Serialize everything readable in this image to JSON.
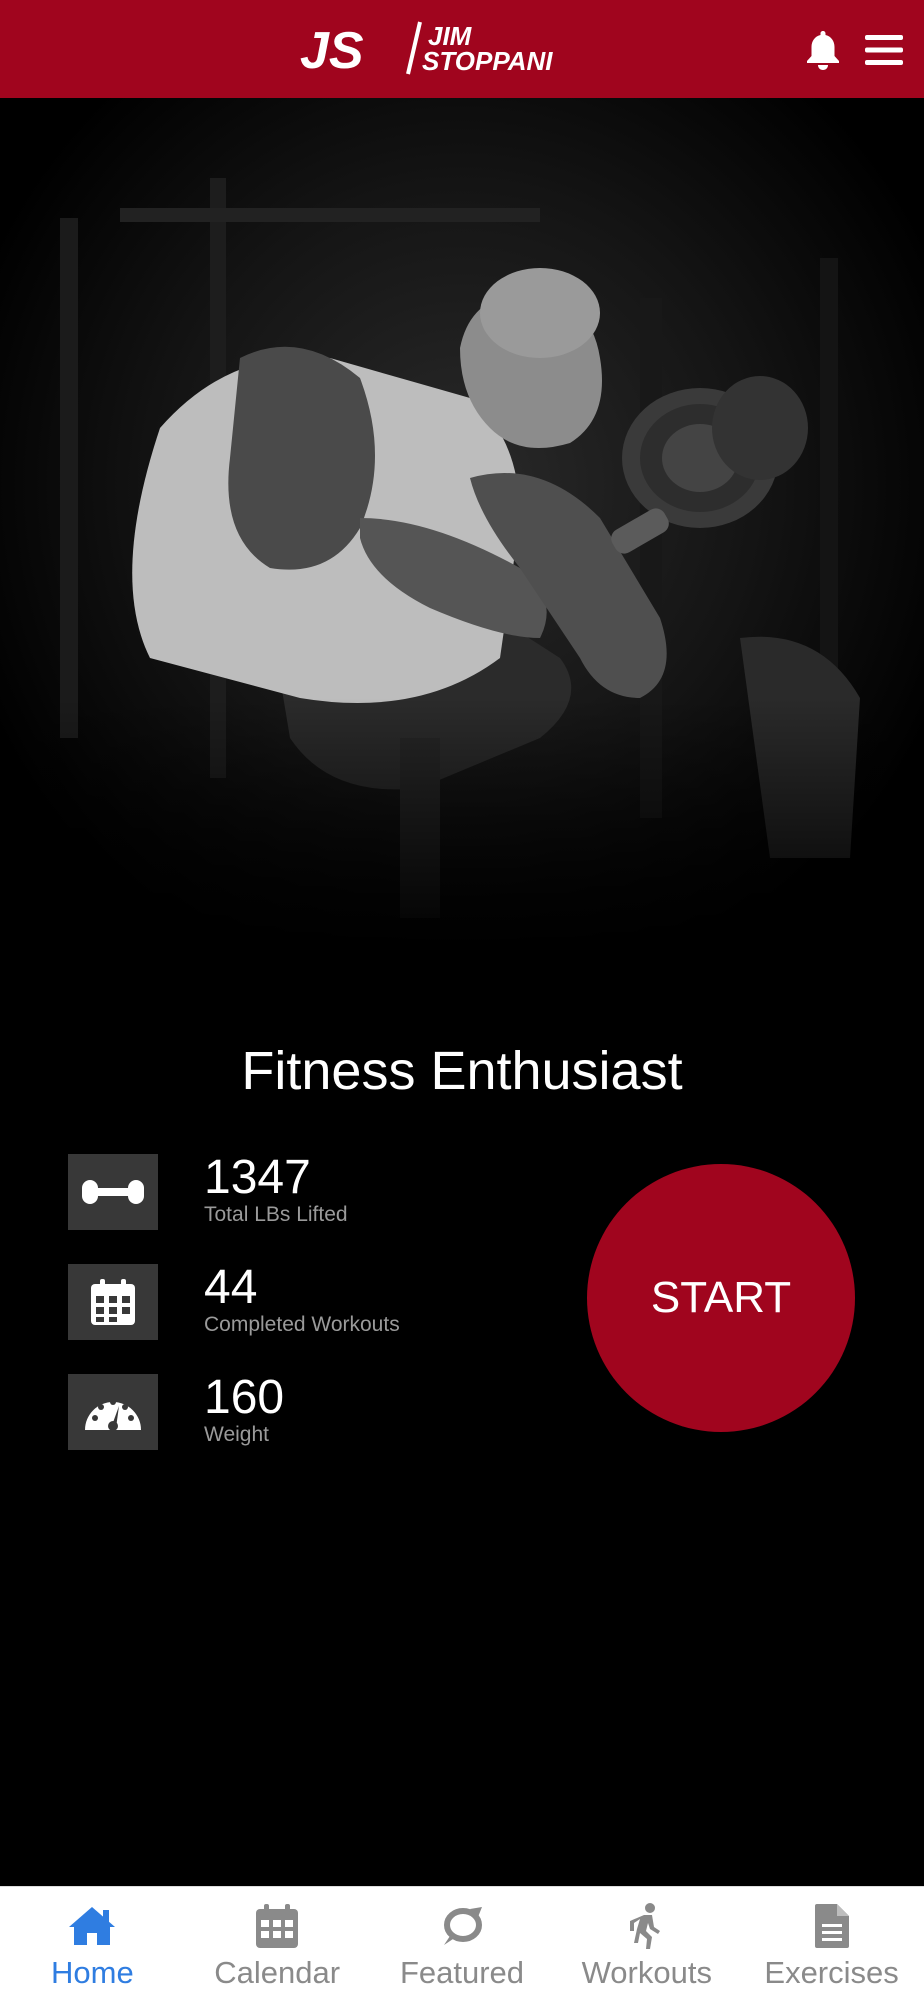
{
  "header": {
    "logo_text_initials": "JS",
    "logo_text_name_line1": "JIM",
    "logo_text_name_line2": "STOPPANI",
    "brand_color": "#a0051e",
    "bell_icon": "bell-icon",
    "menu_icon": "hamburger-menu-icon"
  },
  "hero": {
    "image_icon": "athlete-photo"
  },
  "profile": {
    "title": "Fitness Enthusiast",
    "stats": [
      {
        "icon": "dumbbell-icon",
        "value": "1347",
        "label": "Total LBs Lifted"
      },
      {
        "icon": "calendar-icon",
        "value": "44",
        "label": "Completed Workouts"
      },
      {
        "icon": "speedometer-icon",
        "value": "160",
        "label": "Weight"
      }
    ],
    "start_label": "START"
  },
  "bottom_nav": {
    "active_color": "#2f7de1",
    "items": [
      {
        "label": "Home",
        "icon": "home-icon",
        "active": true
      },
      {
        "label": "Calendar",
        "icon": "calendar-icon",
        "active": false
      },
      {
        "label": "Featured",
        "icon": "featured-icon",
        "active": false
      },
      {
        "label": "Workouts",
        "icon": "walking-person-icon",
        "active": false
      },
      {
        "label": "Exercises",
        "icon": "document-icon",
        "active": false
      }
    ]
  }
}
